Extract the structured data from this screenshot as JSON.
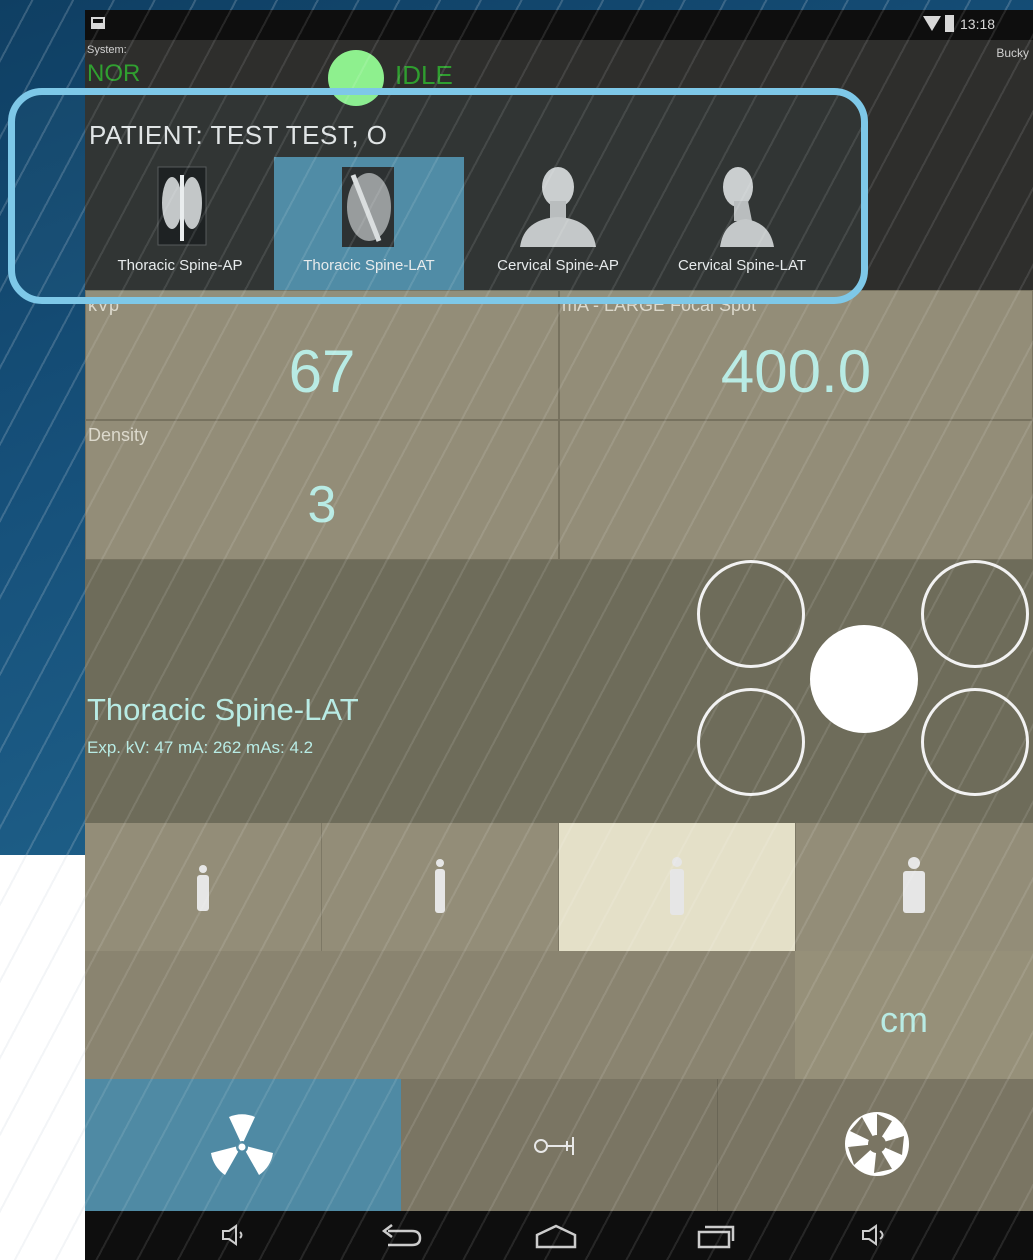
{
  "status_bar": {
    "clock": "13:18"
  },
  "header": {
    "system_label": "System:",
    "system_value": "NOR",
    "status_text": "IDLE",
    "bucky_label": "Bucky",
    "patient_title": "PATIENT: TEST TEST, O"
  },
  "studies": [
    {
      "label": "Thoracic Spine-AP",
      "selected": false
    },
    {
      "label": "Thoracic Spine-LAT",
      "selected": true
    },
    {
      "label": "Cervical Spine-AP",
      "selected": false
    },
    {
      "label": "Cervical Spine-LAT",
      "selected": false
    }
  ],
  "params": {
    "kvp_label": "kVp",
    "kvp_value": "67",
    "ma_label": "mA - LARGE Focal Spot",
    "ma_value": "400.0",
    "density_label": "Density",
    "density_value": "3"
  },
  "exam": {
    "name": "Thoracic Spine-LAT",
    "factors": "Exp. kV: 47  mA: 262  mAs: 4.2"
  },
  "patient_size": {
    "selected_index": 2
  },
  "thickness": {
    "unit": "cm"
  },
  "bottom_tabs": [
    "radiation-icon",
    "key-icon",
    "shutter-icon"
  ],
  "colors": {
    "accent": "#4f8aa4",
    "value_text": "#b8ebe4",
    "highlight": "#7ec8e8",
    "status_green": "#8ef08e"
  }
}
